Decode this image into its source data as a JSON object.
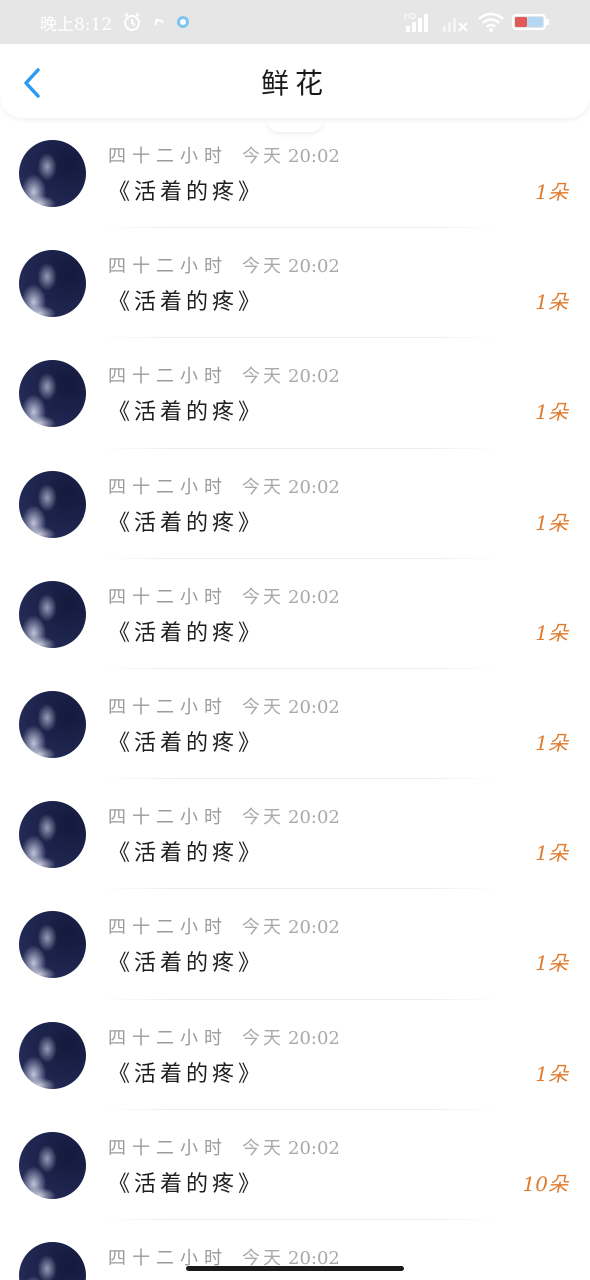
{
  "status_bar": {
    "time": "晚上8:12",
    "network_badge": "HD",
    "battery_color": "#e05a5a"
  },
  "header": {
    "title": "鲜花",
    "back_icon": "chevron-left-icon",
    "accent_color": "#2b9af3"
  },
  "flowers": [
    {
      "author": "四十二小时",
      "day": "今天",
      "time": "20:02",
      "book": "《活着的疼》",
      "count": "1朵"
    },
    {
      "author": "四十二小时",
      "day": "今天",
      "time": "20:02",
      "book": "《活着的疼》",
      "count": "1朵"
    },
    {
      "author": "四十二小时",
      "day": "今天",
      "time": "20:02",
      "book": "《活着的疼》",
      "count": "1朵"
    },
    {
      "author": "四十二小时",
      "day": "今天",
      "time": "20:02",
      "book": "《活着的疼》",
      "count": "1朵"
    },
    {
      "author": "四十二小时",
      "day": "今天",
      "time": "20:02",
      "book": "《活着的疼》",
      "count": "1朵"
    },
    {
      "author": "四十二小时",
      "day": "今天",
      "time": "20:02",
      "book": "《活着的疼》",
      "count": "1朵"
    },
    {
      "author": "四十二小时",
      "day": "今天",
      "time": "20:02",
      "book": "《活着的疼》",
      "count": "1朵"
    },
    {
      "author": "四十二小时",
      "day": "今天",
      "time": "20:02",
      "book": "《活着的疼》",
      "count": "1朵"
    },
    {
      "author": "四十二小时",
      "day": "今天",
      "time": "20:02",
      "book": "《活着的疼》",
      "count": "1朵"
    },
    {
      "author": "四十二小时",
      "day": "今天",
      "time": "20:02",
      "book": "《活着的疼》",
      "count": "10朵"
    },
    {
      "author": "四十二小时",
      "day": "今天",
      "time": "20:02",
      "book": "",
      "count": ""
    }
  ],
  "count_color": "#e07a2c"
}
